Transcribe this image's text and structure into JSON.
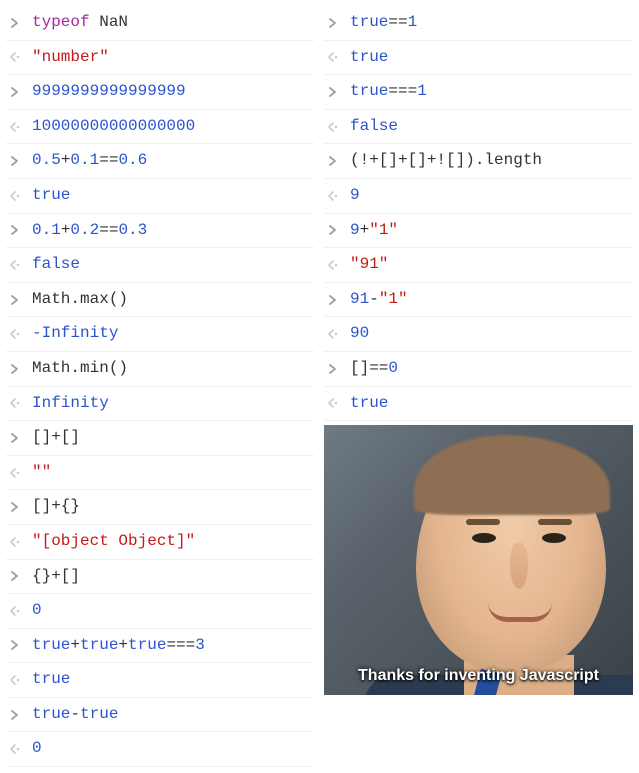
{
  "col1": [
    {
      "kind": "input",
      "tokens": [
        [
          "typeof ",
          "keyword"
        ],
        [
          "NaN",
          "plain"
        ]
      ]
    },
    {
      "kind": "output",
      "tokens": [
        [
          "\"number\"",
          "string"
        ]
      ]
    },
    {
      "kind": "input",
      "tokens": [
        [
          "9999999999999999",
          "number"
        ]
      ]
    },
    {
      "kind": "output",
      "tokens": [
        [
          "10000000000000000",
          "number"
        ]
      ]
    },
    {
      "kind": "input",
      "tokens": [
        [
          "0.5",
          "number"
        ],
        [
          "+",
          "plain"
        ],
        [
          "0.1",
          "number"
        ],
        [
          "==",
          "plain"
        ],
        [
          "0.6",
          "number"
        ]
      ]
    },
    {
      "kind": "output",
      "tokens": [
        [
          "true",
          "bool"
        ]
      ]
    },
    {
      "kind": "input",
      "tokens": [
        [
          "0.1",
          "number"
        ],
        [
          "+",
          "plain"
        ],
        [
          "0.2",
          "number"
        ],
        [
          "==",
          "plain"
        ],
        [
          "0.3",
          "number"
        ]
      ]
    },
    {
      "kind": "output",
      "tokens": [
        [
          "false",
          "bool"
        ]
      ]
    },
    {
      "kind": "input",
      "tokens": [
        [
          "Math",
          "plain"
        ],
        [
          ".max()",
          "func"
        ]
      ]
    },
    {
      "kind": "output",
      "tokens": [
        [
          "-Infinity",
          "infinity"
        ]
      ]
    },
    {
      "kind": "input",
      "tokens": [
        [
          "Math",
          "plain"
        ],
        [
          ".min()",
          "func"
        ]
      ]
    },
    {
      "kind": "output",
      "tokens": [
        [
          "Infinity",
          "infinity"
        ]
      ]
    },
    {
      "kind": "input",
      "tokens": [
        [
          "[]+[]",
          "plain"
        ]
      ]
    },
    {
      "kind": "output",
      "tokens": [
        [
          "\"\"",
          "string"
        ]
      ]
    },
    {
      "kind": "input",
      "tokens": [
        [
          "[]+{}",
          "plain"
        ]
      ]
    },
    {
      "kind": "output",
      "tokens": [
        [
          "\"[object Object]\"",
          "string"
        ]
      ]
    },
    {
      "kind": "input",
      "tokens": [
        [
          "{}+[]",
          "plain"
        ]
      ]
    },
    {
      "kind": "output",
      "tokens": [
        [
          "0",
          "number"
        ]
      ]
    },
    {
      "kind": "input",
      "tokens": [
        [
          "true",
          "bool"
        ],
        [
          "+",
          "plain"
        ],
        [
          "true",
          "bool"
        ],
        [
          "+",
          "plain"
        ],
        [
          "true",
          "bool"
        ],
        [
          "===",
          "plain"
        ],
        [
          "3",
          "number"
        ]
      ]
    },
    {
      "kind": "output",
      "tokens": [
        [
          "true",
          "bool"
        ]
      ]
    },
    {
      "kind": "input",
      "tokens": [
        [
          "true",
          "bool"
        ],
        [
          "-",
          "plain"
        ],
        [
          "true",
          "bool"
        ]
      ]
    },
    {
      "kind": "output",
      "tokens": [
        [
          "0",
          "number"
        ]
      ]
    }
  ],
  "col2": [
    {
      "kind": "input",
      "tokens": [
        [
          "true",
          "bool"
        ],
        [
          "==",
          "plain"
        ],
        [
          "1",
          "number"
        ]
      ]
    },
    {
      "kind": "output",
      "tokens": [
        [
          "true",
          "bool"
        ]
      ]
    },
    {
      "kind": "input",
      "tokens": [
        [
          "true",
          "bool"
        ],
        [
          "===",
          "plain"
        ],
        [
          "1",
          "number"
        ]
      ]
    },
    {
      "kind": "output",
      "tokens": [
        [
          "false",
          "bool"
        ]
      ]
    },
    {
      "kind": "input",
      "tokens": [
        [
          "(!+[]+[]+![]).length",
          "plain"
        ]
      ]
    },
    {
      "kind": "output",
      "tokens": [
        [
          "9",
          "number"
        ]
      ]
    },
    {
      "kind": "input",
      "tokens": [
        [
          "9",
          "number"
        ],
        [
          "+",
          "plain"
        ],
        [
          "\"1\"",
          "string"
        ]
      ]
    },
    {
      "kind": "output",
      "tokens": [
        [
          "\"91\"",
          "string"
        ]
      ]
    },
    {
      "kind": "input",
      "tokens": [
        [
          "91",
          "number"
        ],
        [
          "-",
          "plain"
        ],
        [
          "\"1\"",
          "string"
        ]
      ]
    },
    {
      "kind": "output",
      "tokens": [
        [
          "90",
          "number"
        ]
      ]
    },
    {
      "kind": "input",
      "tokens": [
        [
          "[]==",
          "plain"
        ],
        [
          "0",
          "number"
        ]
      ]
    },
    {
      "kind": "output",
      "tokens": [
        [
          "true",
          "bool"
        ]
      ]
    }
  ],
  "caption": "Thanks for inventing Javascript"
}
